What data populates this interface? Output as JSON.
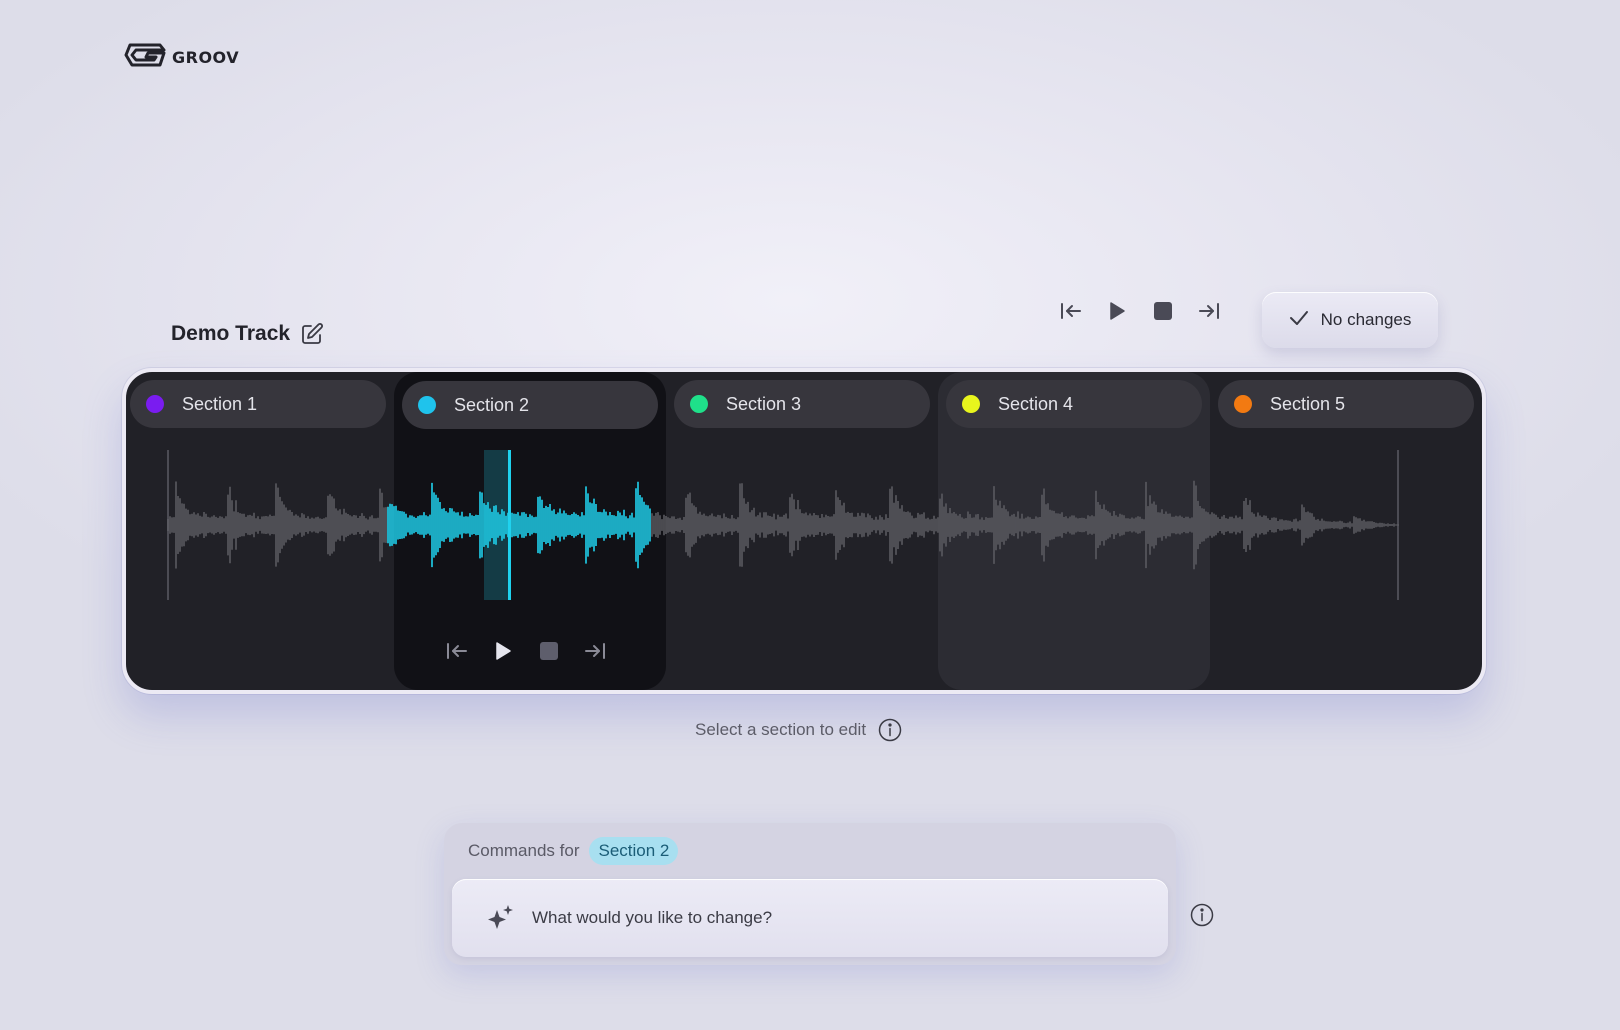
{
  "brand": {
    "name": "GROOV"
  },
  "track": {
    "title": "Demo Track"
  },
  "status": {
    "label": "No changes"
  },
  "sections": [
    {
      "label": "Section 1",
      "color": "#7a1cf0"
    },
    {
      "label": "Section 2",
      "color": "#1fc3ec"
    },
    {
      "label": "Section 3",
      "color": "#1fe08a"
    },
    {
      "label": "Section 4",
      "color": "#e8f51d"
    },
    {
      "label": "Section 5",
      "color": "#f27a12"
    }
  ],
  "selected_section": "Section 2",
  "colors": {
    "accent": "#1fd2ee",
    "waveform_inactive": "#5a5a60",
    "timeline_bg": "#212127"
  },
  "hint": {
    "text": "Select a section to edit"
  },
  "commands": {
    "prefix": "Commands for",
    "section_tag": "Section 2",
    "input_placeholder": "What would you like to change?"
  },
  "icons": {
    "logo": "groov-logo-icon",
    "edit": "edit-pencil-icon",
    "skip_back": "skip-to-start-icon",
    "play": "play-icon",
    "stop": "stop-icon",
    "skip_forward": "skip-to-end-icon",
    "check": "check-icon",
    "info": "info-icon",
    "sparkle": "sparkle-icon"
  }
}
